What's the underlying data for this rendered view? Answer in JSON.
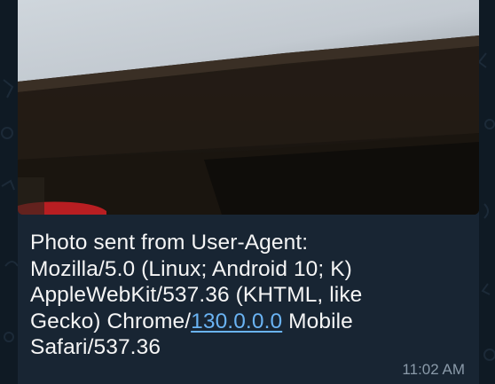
{
  "message": {
    "caption_lines": [
      "Photo sent from User-Agent:",
      "Mozilla/5.0 (Linux; Android 10; K)",
      "AppleWebKit/537.36 (KHTML, like",
      "Gecko) Chrome/",
      "Mobile",
      "Safari/537.36"
    ],
    "link_text": "130.0.0.0",
    "time": "11:02 AM"
  },
  "colors": {
    "chat_background": "#0f1a24",
    "bubble": "#182533",
    "link": "#6ab3f3",
    "text": "#f5f5f5",
    "timestamp": "#8a9aa9"
  }
}
